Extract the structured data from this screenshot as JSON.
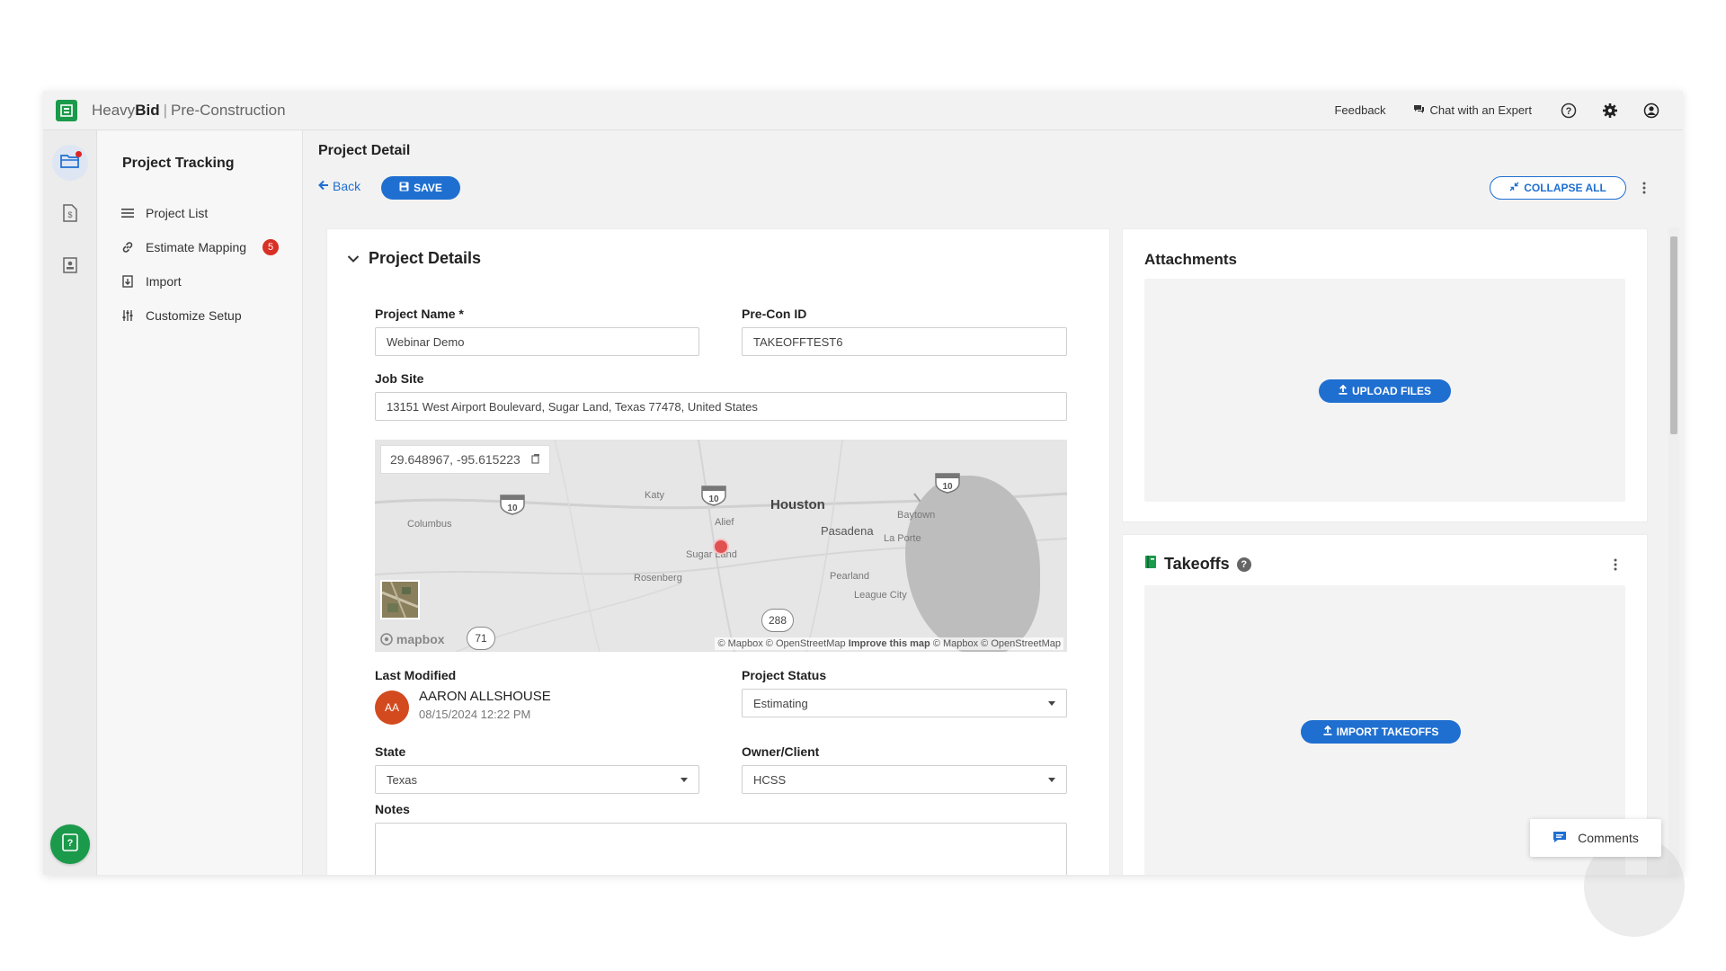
{
  "header": {
    "brand_main": "Heavy",
    "brand_bold": "Bid",
    "brand_sep": "|",
    "brand_product": "Pre-Construction",
    "feedback": "Feedback",
    "chat": "Chat with an Expert"
  },
  "subnav": {
    "title": "Project Tracking",
    "items": [
      {
        "label": "Project List",
        "icon": "list-icon"
      },
      {
        "label": "Estimate Mapping",
        "icon": "link-icon",
        "badge": "5"
      },
      {
        "label": "Import",
        "icon": "import-icon"
      },
      {
        "label": "Customize Setup",
        "icon": "sliders-icon"
      }
    ]
  },
  "page": {
    "title": "Project Detail",
    "back": "Back",
    "save": "SAVE",
    "collapse_all": "COLLAPSE ALL"
  },
  "details": {
    "section_title": "Project Details",
    "project_name_label": "Project Name *",
    "project_name_value": "Webinar Demo",
    "precon_label": "Pre-Con ID",
    "precon_value": "TAKEOFFTEST6",
    "jobsite_label": "Job Site",
    "jobsite_value": "13151 West Airport Boulevard, Sugar Land, Texas 77478, United States",
    "map": {
      "coords": "29.648967, -95.615223",
      "labels": {
        "houston": "Houston",
        "pasadena": "Pasadena",
        "katy": "Katy",
        "alief": "Alief",
        "sugar_land": "Sugar Land",
        "columbus": "Columbus",
        "rosenberg": "Rosenberg",
        "pearland": "Pearland",
        "league_city": "League City",
        "baytown": "Baytown",
        "la_porte": "La Porte"
      },
      "routes": {
        "i10_a": "10",
        "i10_b": "10",
        "i10_c": "10",
        "r288": "288",
        "r71": "71"
      },
      "mapbox": "mapbox",
      "attribution_1": "© Mapbox © OpenStreetMap",
      "attribution_improve": "Improve this map",
      "attribution_2": "© Mapbox © OpenStreetMap"
    },
    "last_modified_label": "Last Modified",
    "last_modified_initials": "AA",
    "last_modified_name": "AARON ALLSHOUSE",
    "last_modified_date": "08/15/2024 12:22 PM",
    "status_label": "Project Status",
    "status_value": "Estimating",
    "state_label": "State",
    "state_value": "Texas",
    "owner_label": "Owner/Client",
    "owner_value": "HCSS",
    "notes_label": "Notes"
  },
  "attachments": {
    "title": "Attachments",
    "upload": "UPLOAD FILES"
  },
  "takeoffs": {
    "title": "Takeoffs",
    "import": "IMPORT TAKEOFFS"
  },
  "comments": "Comments",
  "colors": {
    "accent": "#1f6fd1",
    "brand": "#1a9a4a",
    "badge": "#d93025",
    "avatar": "#d24a1e"
  }
}
